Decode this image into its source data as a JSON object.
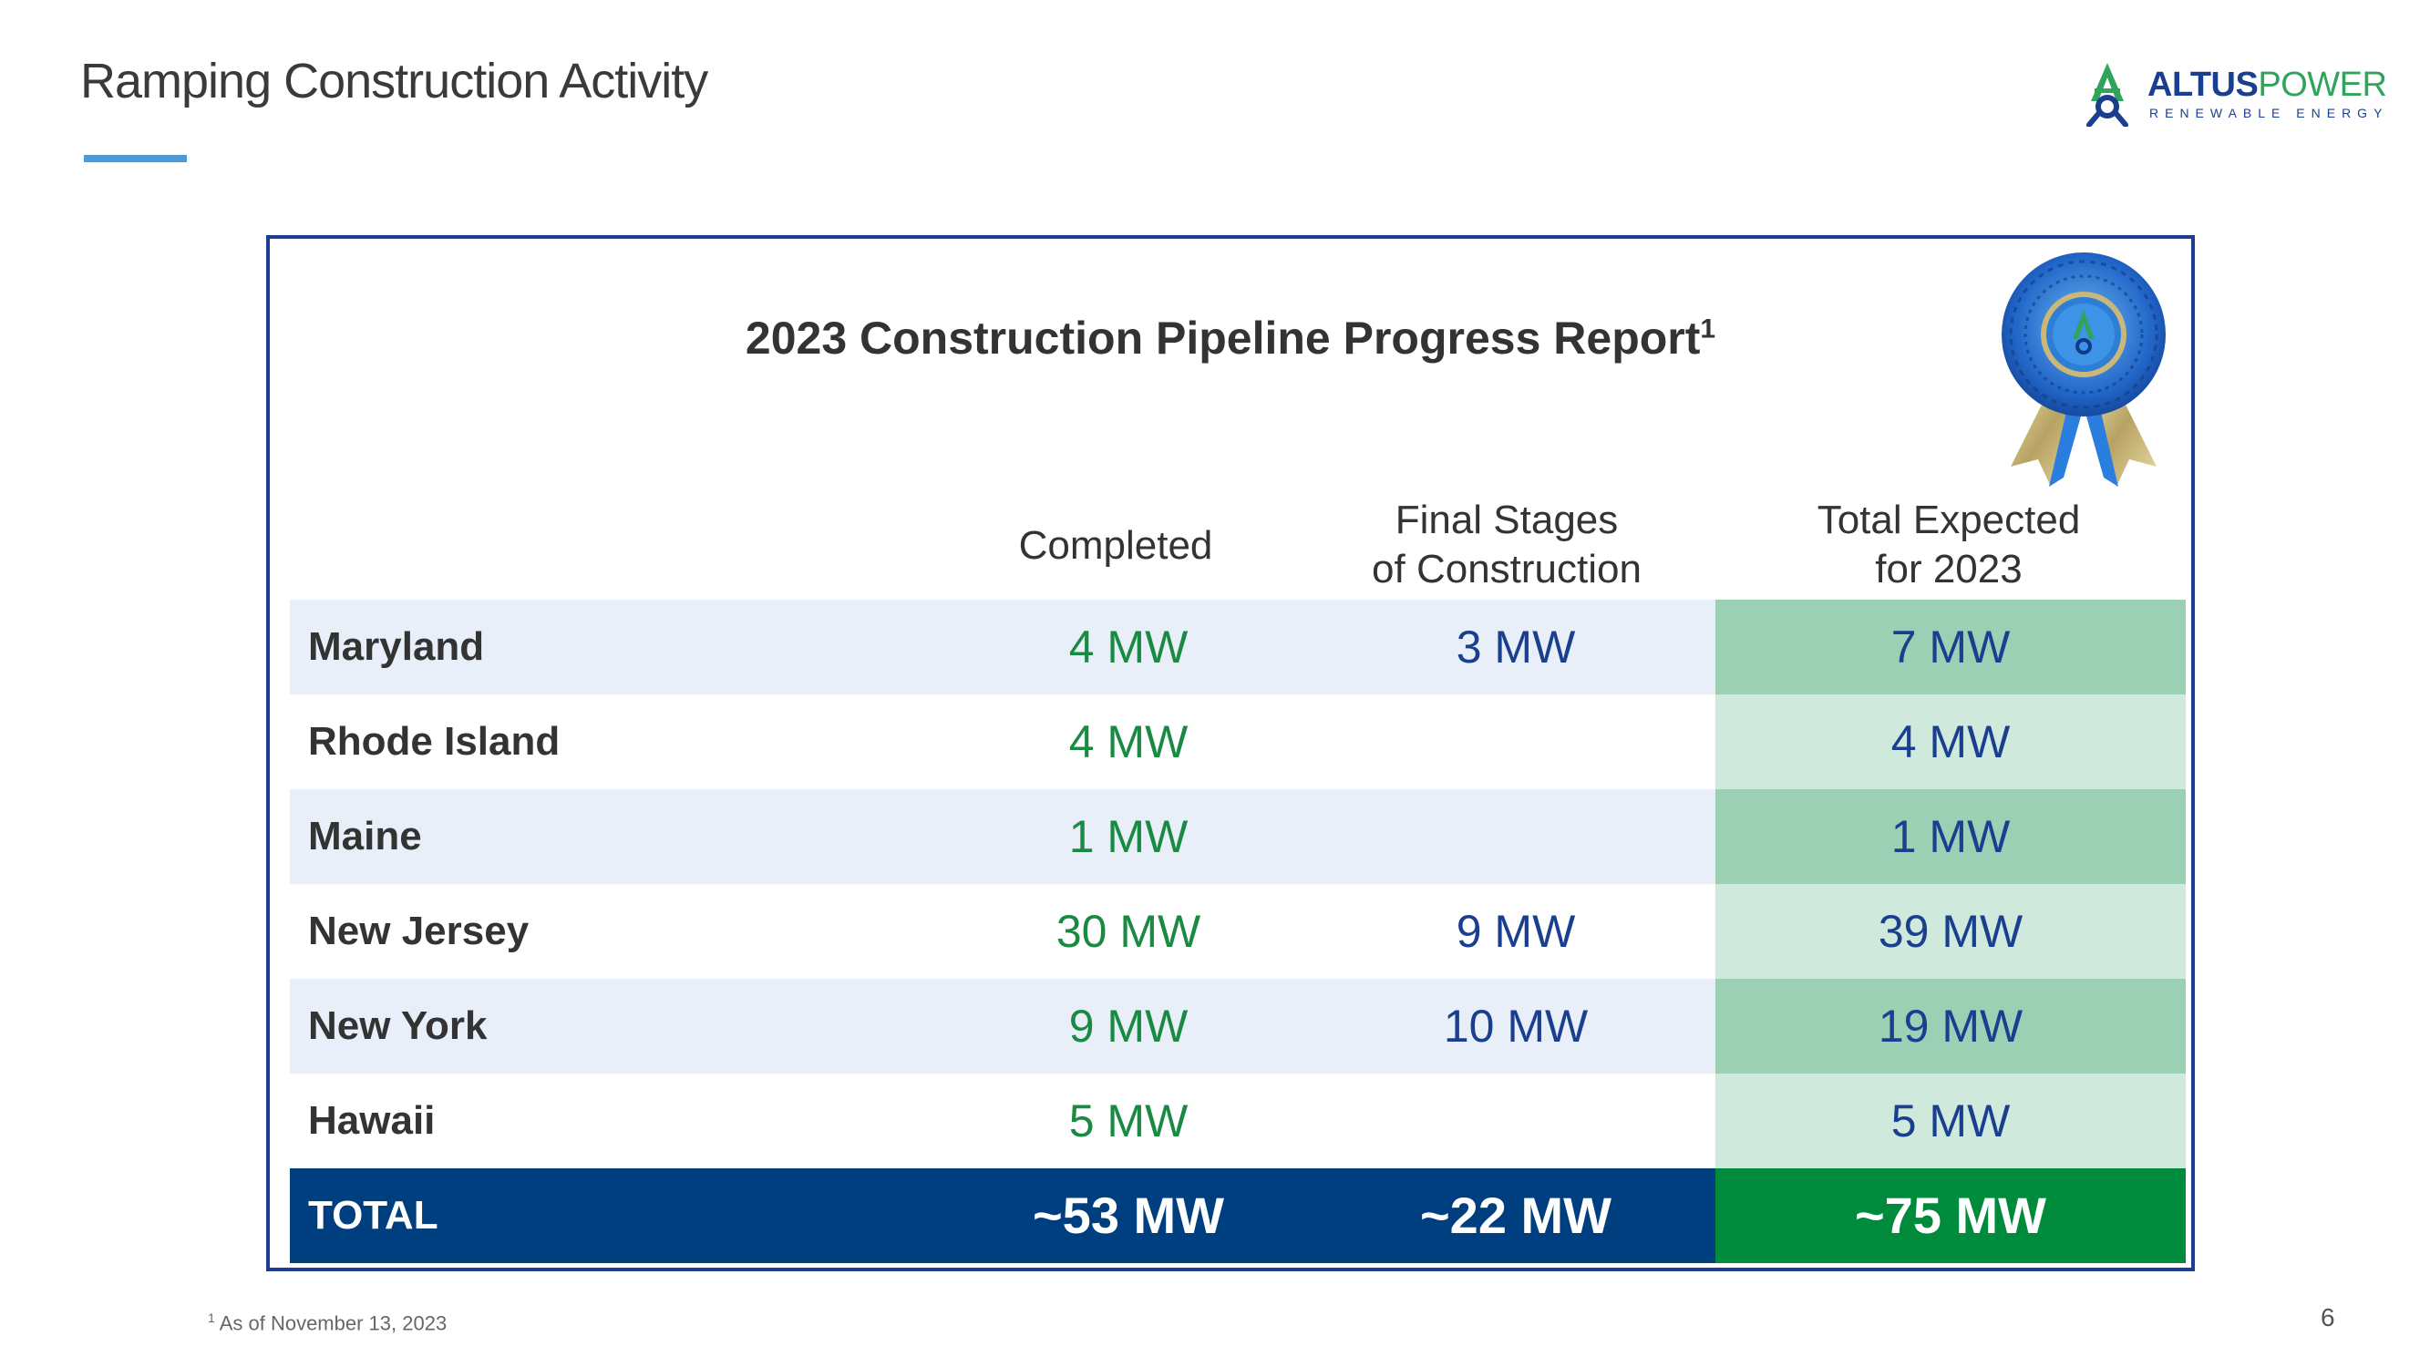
{
  "slide": {
    "title": "Ramping Construction Activity",
    "page_number": "6"
  },
  "logo": {
    "name_part1": "ALTUS",
    "name_part2": "POWER",
    "tagline": "RENEWABLE ENERGY",
    "icon": "altus-power-logo-icon"
  },
  "report": {
    "title": "2023 Construction Pipeline Progress Report",
    "title_footnote_marker": "1",
    "ribbon_icon": "award-ribbon-icon",
    "columns": {
      "completed": "Completed",
      "final_line1": "Final Stages",
      "final_line2": "of Construction",
      "total_line1": "Total Expected",
      "total_line2": "for 2023"
    },
    "rows": [
      {
        "state": "Maryland",
        "completed": "4 MW",
        "final": "3 MW",
        "total": "7 MW"
      },
      {
        "state": "Rhode Island",
        "completed": "4 MW",
        "final": "",
        "total": "4 MW"
      },
      {
        "state": "Maine",
        "completed": "1 MW",
        "final": "",
        "total": "1 MW"
      },
      {
        "state": "New Jersey",
        "completed": "30 MW",
        "final": "9 MW",
        "total": "39 MW"
      },
      {
        "state": "New York",
        "completed": "9 MW",
        "final": "10 MW",
        "total": "19 MW"
      },
      {
        "state": "Hawaii",
        "completed": "5 MW",
        "final": "",
        "total": "5 MW"
      }
    ],
    "total_row": {
      "label": "TOTAL",
      "completed": "~53 MW",
      "final": "~22 MW",
      "total": "~75 MW"
    }
  },
  "footnote": {
    "marker": "1",
    "text": "As of November 13, 2023"
  },
  "colors": {
    "navy": "#003f7f",
    "green": "#008a3c",
    "completed_text": "#1a8a43",
    "value_text": "#1b3f8f",
    "shade": "#e8eff8",
    "total_dark": "#9bd0b5",
    "total_light": "#cfe9dc",
    "title_underline": "#4a9bd8"
  }
}
